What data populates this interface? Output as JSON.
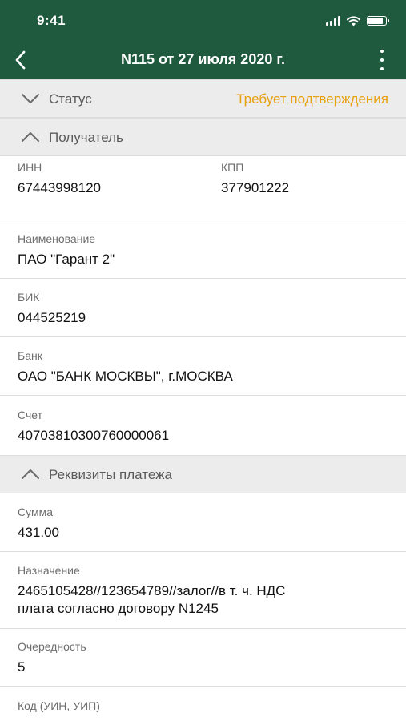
{
  "status_bar": {
    "time": "9:41"
  },
  "nav": {
    "title": "N115 от 27 июля 2020 г."
  },
  "status_section": {
    "label": "Статус",
    "value": "Требует подтверждения"
  },
  "recipient_section": {
    "label": "Получатель",
    "inn": {
      "caption": "ИНН",
      "value": "67443998120"
    },
    "kpp": {
      "caption": "КПП",
      "value": "377901222"
    },
    "name": {
      "caption": "Наименование",
      "value": "ПАО \"Гарант 2\""
    },
    "bik": {
      "caption": "БИК",
      "value": "044525219"
    },
    "bank": {
      "caption": "Банк",
      "value": "ОАО \"БАНК МОСКВЫ\", г.МОСКВА"
    },
    "account": {
      "caption": "Счет",
      "value": "40703810300760000061"
    }
  },
  "payment_section": {
    "label": "Реквизиты платежа",
    "amount": {
      "caption": "Сумма",
      "value": "431.00"
    },
    "purpose": {
      "caption": "Назначение",
      "line1": "2465105428//123654789//залог//в т. ч. НДС",
      "line2": "плата согласно договору N1245"
    },
    "priority": {
      "caption": "Очередность",
      "value": "5"
    },
    "code": {
      "caption": "Код (УИН, УИП)"
    }
  },
  "colors": {
    "header_bg": "#1f5a3f",
    "status_accent": "#e8a00c",
    "section_bg": "#ececec"
  },
  "icons": [
    "signal-icon",
    "wifi-icon",
    "battery-icon",
    "back-arrow-icon",
    "more-vertical-icon",
    "chevron-down-icon",
    "chevron-up-icon"
  ]
}
